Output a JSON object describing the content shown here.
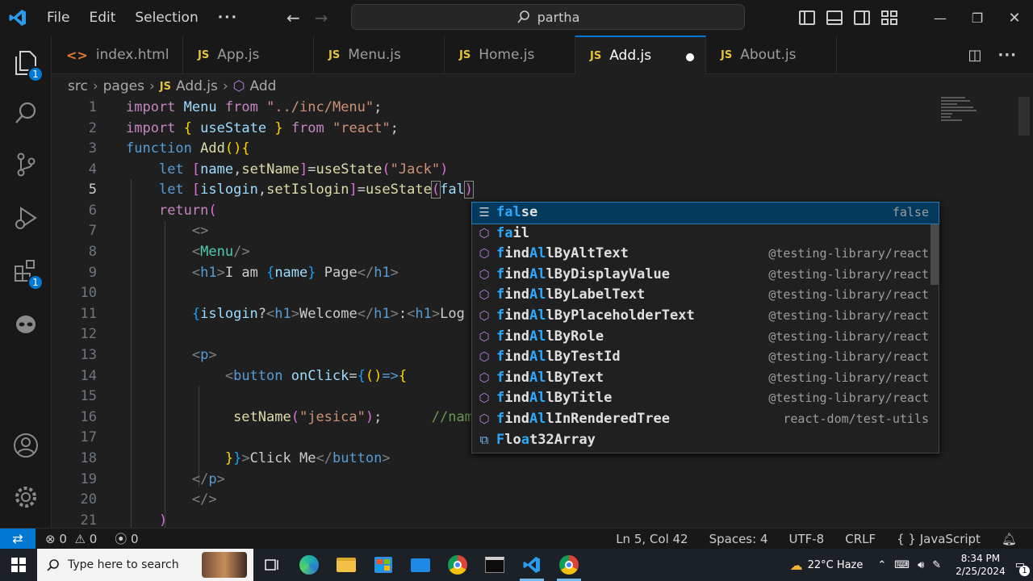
{
  "menubar": {
    "items": [
      "File",
      "Edit",
      "Selection"
    ],
    "more": "···"
  },
  "search": {
    "text": "partha"
  },
  "activity": {
    "explorer_badge": "1",
    "extensions_badge": "1"
  },
  "tabs": [
    {
      "label": "index.html",
      "icon": "html-icon"
    },
    {
      "label": "App.js",
      "icon": "js-icon"
    },
    {
      "label": "Menu.js",
      "icon": "js-icon"
    },
    {
      "label": "Home.js",
      "icon": "js-icon"
    },
    {
      "label": "Add.js",
      "icon": "js-icon",
      "active": true,
      "dirty": true
    },
    {
      "label": "About.js",
      "icon": "js-icon"
    }
  ],
  "tab_icon_text": "JS",
  "breadcrumb": {
    "parts": [
      "src",
      "pages",
      "Add.js",
      "Add"
    ]
  },
  "editor": {
    "line_numbers": [
      "1",
      "2",
      "3",
      "4",
      "5",
      "6",
      "7",
      "8",
      "9",
      "10",
      "11",
      "12",
      "13",
      "14",
      "15",
      "16",
      "17",
      "18",
      "19",
      "20",
      "21"
    ],
    "current_line": "5"
  },
  "suggest": {
    "items": [
      {
        "match": "fal",
        "rest": "se",
        "detail": "false",
        "icon": "keyword-icon"
      },
      {
        "match": "fa",
        "rest": "il",
        "detail": "",
        "icon": "cube-icon",
        "label": "fail"
      },
      {
        "label": "findAllByAltText",
        "detail": "@testing-library/react",
        "icon": "cube-icon"
      },
      {
        "label": "findAllByDisplayValue",
        "detail": "@testing-library/react",
        "icon": "cube-icon"
      },
      {
        "label": "findAllByLabelText",
        "detail": "@testing-library/react",
        "icon": "cube-icon"
      },
      {
        "label": "findAllByPlaceholderText",
        "detail": "@testing-library/react",
        "icon": "cube-icon"
      },
      {
        "label": "findAllByRole",
        "detail": "@testing-library/react",
        "icon": "cube-icon"
      },
      {
        "label": "findAllByTestId",
        "detail": "@testing-library/react",
        "icon": "cube-icon"
      },
      {
        "label": "findAllByText",
        "detail": "@testing-library/react",
        "icon": "cube-icon"
      },
      {
        "label": "findAllByTitle",
        "detail": "@testing-library/react",
        "icon": "cube-icon"
      },
      {
        "label": "findAllInRenderedTree",
        "detail": "react-dom/test-utils",
        "icon": "cube-icon"
      },
      {
        "label": "Float32Array",
        "detail": "",
        "icon": "class-icon"
      }
    ]
  },
  "status": {
    "errors": "0",
    "warnings": "0",
    "ports": "0",
    "position": "Ln 5, Col 42",
    "spaces": "Spaces: 4",
    "encoding": "UTF-8",
    "eol": "CRLF",
    "language": "JavaScript"
  },
  "taskbar": {
    "search_placeholder": "Type here to search",
    "weather": "22°C Haze",
    "time": "8:34 PM",
    "date": "2/25/2024",
    "notification_count": "1"
  },
  "colors": {
    "accent": "#0078d4",
    "tab_js": "#e5c33d",
    "suggest_selected": "#04395e"
  }
}
